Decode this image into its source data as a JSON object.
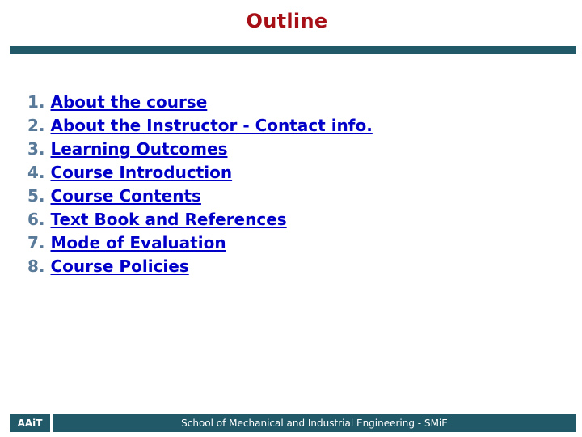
{
  "slide": {
    "title": "Outline",
    "items": [
      {
        "number": "1.",
        "label": "About the course"
      },
      {
        "number": "2.",
        "label": "About the Instructor - Contact info."
      },
      {
        "number": "3.",
        "label": "Learning Outcomes"
      },
      {
        "number": "4.",
        "label": "Course Introduction"
      },
      {
        "number": "5.",
        "label": "Course Contents"
      },
      {
        "number": "6.",
        "label": "Text Book and References"
      },
      {
        "number": "7.",
        "label": "Mode of Evaluation"
      },
      {
        "number": "8.",
        "label": "Course Policies"
      }
    ]
  },
  "footer": {
    "left": "AAiT",
    "main": "School of Mechanical and Industrial Engineering - SMiE"
  },
  "colors": {
    "title": "#a50f15",
    "bar": "#215968",
    "link": "#0000c8",
    "number": "#5a7a9a"
  }
}
